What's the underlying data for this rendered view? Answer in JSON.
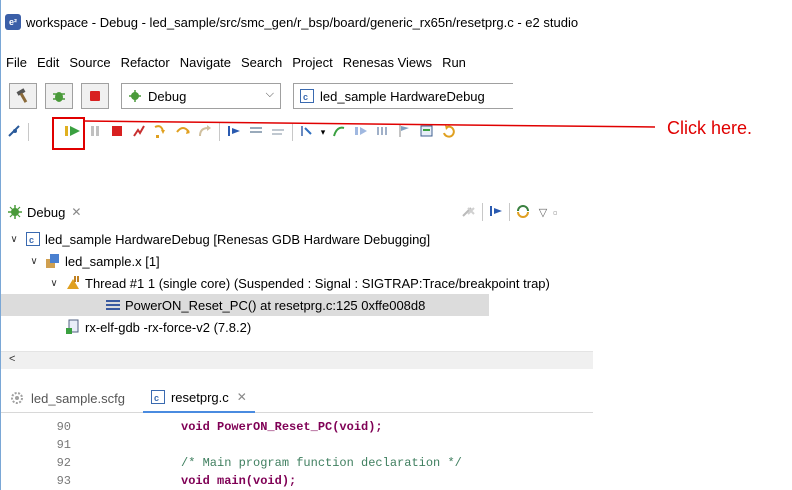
{
  "window": {
    "title": "workspace - Debug - led_sample/src/smc_gen/r_bsp/board/generic_rx65n/resetprg.c - e2 studio"
  },
  "menu": [
    "File",
    "Edit",
    "Source",
    "Refactor",
    "Navigate",
    "Search",
    "Project",
    "Renesas Views",
    "Run"
  ],
  "toolbar": {
    "build_config": "Debug",
    "launch_config": "led_sample HardwareDebug"
  },
  "debug_view": {
    "tab_label": "Debug",
    "tree": [
      {
        "label": "led_sample HardwareDebug [Renesas GDB Hardware Debugging]",
        "level": 0,
        "expanded": true
      },
      {
        "label": "led_sample.x [1]",
        "level": 1,
        "expanded": true
      },
      {
        "label": "Thread #1 1 (single core) (Suspended : Signal : SIGTRAP:Trace/breakpoint trap)",
        "level": 2,
        "expanded": true
      },
      {
        "label": "PowerON_Reset_PC() at resetprg.c:125 0xffe008d8",
        "level": 3,
        "selected": true
      },
      {
        "label": "rx-elf-gdb -rx-force-v2 (7.8.2)",
        "level": 1
      }
    ]
  },
  "editor": {
    "tabs": [
      {
        "label": "led_sample.scfg",
        "active": false
      },
      {
        "label": "resetprg.c",
        "active": true
      }
    ],
    "lines": [
      {
        "num": "90",
        "text": "void PowerON_Reset_PC(void);"
      },
      {
        "num": "91",
        "text": ""
      },
      {
        "num": "92",
        "text": "/* Main program function declaration */"
      },
      {
        "num": "93",
        "text": "void main(void);"
      }
    ]
  },
  "callout": {
    "text": "Click here.",
    "color": "#e00000"
  }
}
